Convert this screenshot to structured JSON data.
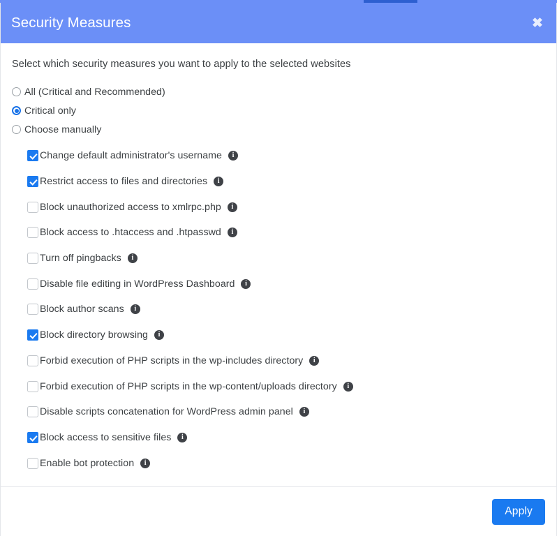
{
  "dialog": {
    "title": "Security Measures",
    "close_icon": "close-icon",
    "intro": "Select which security measures you want to apply to the selected websites",
    "header_color": "#6b8ff7",
    "accent_color": "#1a7af0"
  },
  "scope": {
    "options": [
      {
        "label": "All (Critical and Recommended)",
        "selected": false
      },
      {
        "label": "Critical only",
        "selected": true
      },
      {
        "label": "Choose manually",
        "selected": false
      }
    ]
  },
  "measures": [
    {
      "label": "Change default administrator's username",
      "checked": true,
      "info": "i"
    },
    {
      "label": "Restrict access to files and directories",
      "checked": true,
      "info": "i"
    },
    {
      "label": "Block unauthorized access to xmlrpc.php",
      "checked": false,
      "info": "i"
    },
    {
      "label": "Block access to .htaccess and .htpasswd",
      "checked": false,
      "info": "i"
    },
    {
      "label": "Turn off pingbacks",
      "checked": false,
      "info": "i"
    },
    {
      "label": "Disable file editing in WordPress Dashboard",
      "checked": false,
      "info": "i"
    },
    {
      "label": "Block author scans",
      "checked": false,
      "info": "i"
    },
    {
      "label": "Block directory browsing",
      "checked": true,
      "info": "i"
    },
    {
      "label": "Forbid execution of PHP scripts in the wp-includes directory",
      "checked": false,
      "info": "i"
    },
    {
      "label": "Forbid execution of PHP scripts in the wp-content/uploads directory",
      "checked": false,
      "info": "i"
    },
    {
      "label": "Disable scripts concatenation for WordPress admin panel",
      "checked": false,
      "info": "i"
    },
    {
      "label": "Block access to sensitive files",
      "checked": true,
      "info": "i"
    },
    {
      "label": "Enable bot protection",
      "checked": false,
      "info": "i"
    }
  ],
  "footer": {
    "apply_label": "Apply"
  }
}
